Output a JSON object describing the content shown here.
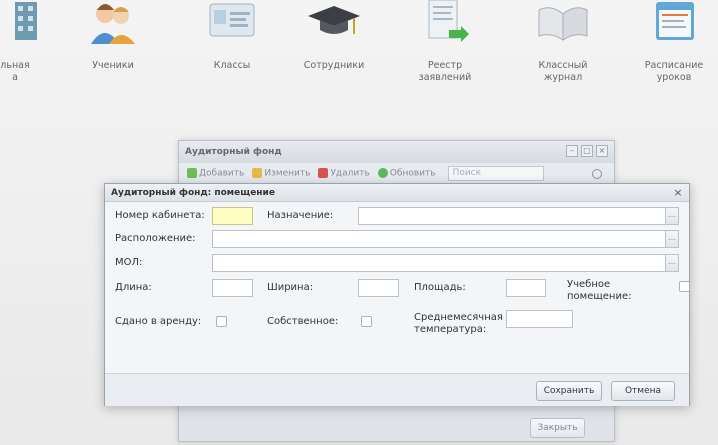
{
  "launcher": {
    "items": [
      {
        "label": "льная\nа"
      },
      {
        "label": "Ученики"
      },
      {
        "label": "Классы"
      },
      {
        "label": "Сотрудники"
      },
      {
        "label": "Реестр\nзаявлений"
      },
      {
        "label": "Классный\nжурнал"
      },
      {
        "label": "Расписание\nуроков"
      }
    ]
  },
  "bg_window": {
    "title": "Аудиторный фонд",
    "toolbar": {
      "add": "Добавить",
      "edit": "Изменить",
      "delete": "Удалить",
      "refresh": "Обновить",
      "search_placeholder": "Поиск"
    },
    "close_label": "Закрыть"
  },
  "dialog": {
    "title": "Аудиторный фонд: помещение",
    "fields": {
      "room_number": {
        "label": "Номер кабинета:",
        "value": ""
      },
      "purpose": {
        "label": "Назначение:",
        "value": ""
      },
      "location": {
        "label": "Расположение:",
        "value": ""
      },
      "mol": {
        "label": "МОЛ:",
        "value": ""
      },
      "length": {
        "label": "Длина:",
        "value": ""
      },
      "width": {
        "label": "Ширина:",
        "value": ""
      },
      "area": {
        "label": "Площадь:",
        "value": ""
      },
      "educational": {
        "label": "Учебное\nпомещение:"
      },
      "rented": {
        "label": "Сдано в аренду:"
      },
      "own": {
        "label": "Собственное:"
      },
      "avg_temp": {
        "label": "Среднемесячная\nтемпература:",
        "value": ""
      }
    },
    "buttons": {
      "save": "Сохранить",
      "cancel": "Отмена"
    }
  },
  "colors": {
    "accent_input": "#fffec2",
    "dialog_bg": "#f3f5f7"
  }
}
